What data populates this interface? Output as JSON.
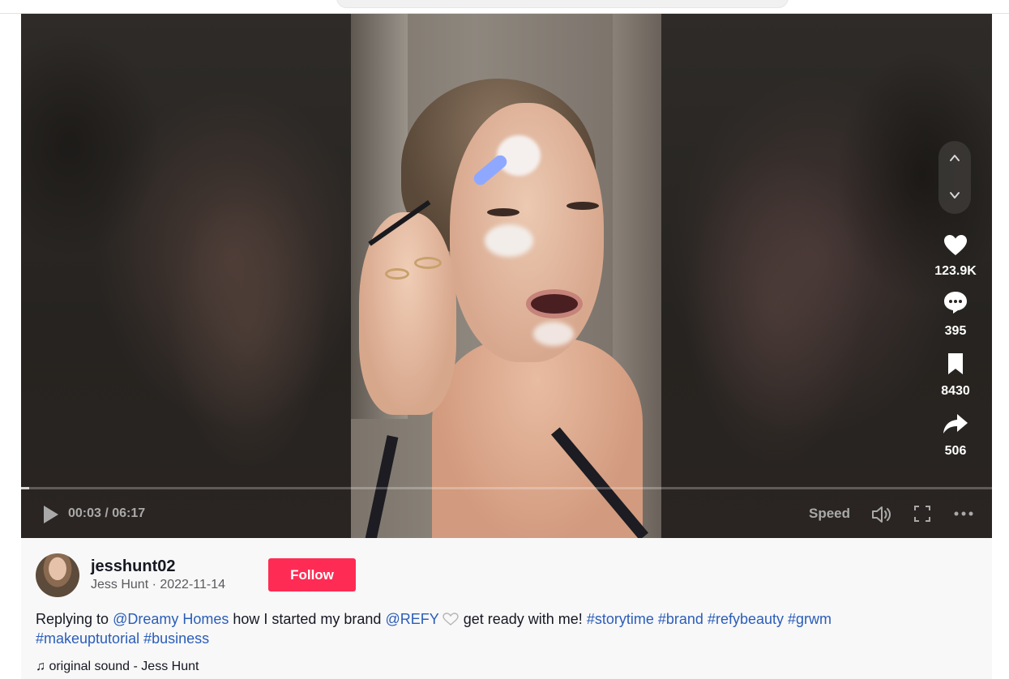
{
  "header": {
    "search_bar": ""
  },
  "video": {
    "progress_fraction": 0.008,
    "time": "00:03 / 06:17",
    "speed_label": "Speed"
  },
  "actions": {
    "likes": "123.9K",
    "comments": "395",
    "saves": "8430",
    "shares": "506"
  },
  "author": {
    "username": "jesshunt02",
    "subline": "Jess Hunt · 2022-11-14",
    "follow_label": "Follow"
  },
  "description": {
    "prefix": "Replying to ",
    "mention1": "@Dreamy Homes",
    "text1": " how I started my brand ",
    "mention2": "@REFY",
    "text2": "get ready with me! ",
    "tags": [
      "#storytime",
      "#brand",
      "#refybeauty",
      "#grwm",
      "#makeuptutorial",
      "#business"
    ]
  },
  "music": {
    "label": "original sound - Jess Hunt"
  },
  "colors": {
    "follow_button": "#fe2c55",
    "link": "#2b5db9"
  }
}
